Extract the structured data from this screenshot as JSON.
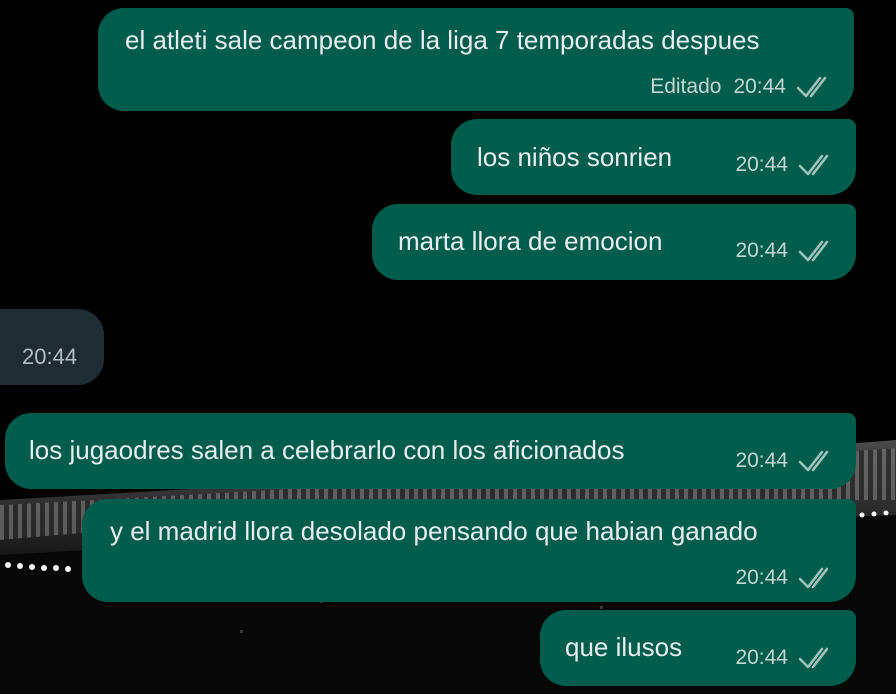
{
  "theme": {
    "background": "#000000",
    "outgoing_bubble": "#005C4B",
    "incoming_bubble": "#1F2C34",
    "text": "#E9EDEF",
    "meta_text": "#C2D7D1",
    "tick_color": "#9FC2BA"
  },
  "messages": [
    {
      "direction": "outgoing",
      "text": "el atleti sale campeon de la liga 7 temporadas despues",
      "edited_label": "Editado",
      "time": "20:44",
      "status": "double-check-icon"
    },
    {
      "direction": "outgoing",
      "text": "los niños sonrien",
      "time": "20:44",
      "status": "double-check-icon"
    },
    {
      "direction": "outgoing",
      "text": "marta llora de emocion",
      "time": "20:44",
      "status": "double-check-icon"
    },
    {
      "direction": "incoming",
      "text": "",
      "time": "20:44"
    },
    {
      "direction": "outgoing",
      "text": "los jugaodres salen a celebrarlo con los aficionados",
      "time": "20:44",
      "status": "double-check-icon"
    },
    {
      "direction": "outgoing",
      "text": "y el madrid llora desolado pensando que habian ganado",
      "time": "20:44",
      "status": "double-check-icon"
    },
    {
      "direction": "outgoing",
      "text": "que ilusos",
      "time": "20:44",
      "status": "double-check-icon"
    }
  ]
}
